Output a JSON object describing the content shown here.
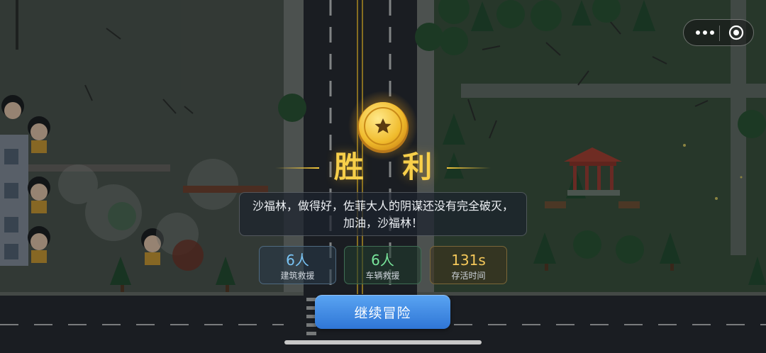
{
  "result": {
    "title": "胜 利",
    "message": [
      "沙福林，做得好，佐菲大人的阴谋还没有完全破灭，",
      "加油，沙福林！"
    ]
  },
  "stats": [
    {
      "value": "6人",
      "label": "建筑救援"
    },
    {
      "value": "6人",
      "label": "车辆救援"
    },
    {
      "value": "131s",
      "label": "存活时间"
    }
  ],
  "continue_label": "继续冒险",
  "colors": {
    "title_gold": "#f7cf4a",
    "button_blue": "#3b86e0",
    "stat_blue": "#79c4f5",
    "stat_green": "#79e59b",
    "stat_gold": "#f5c85a"
  },
  "icons": [
    "more-icon",
    "close-circle-icon",
    "star-medal-icon"
  ]
}
